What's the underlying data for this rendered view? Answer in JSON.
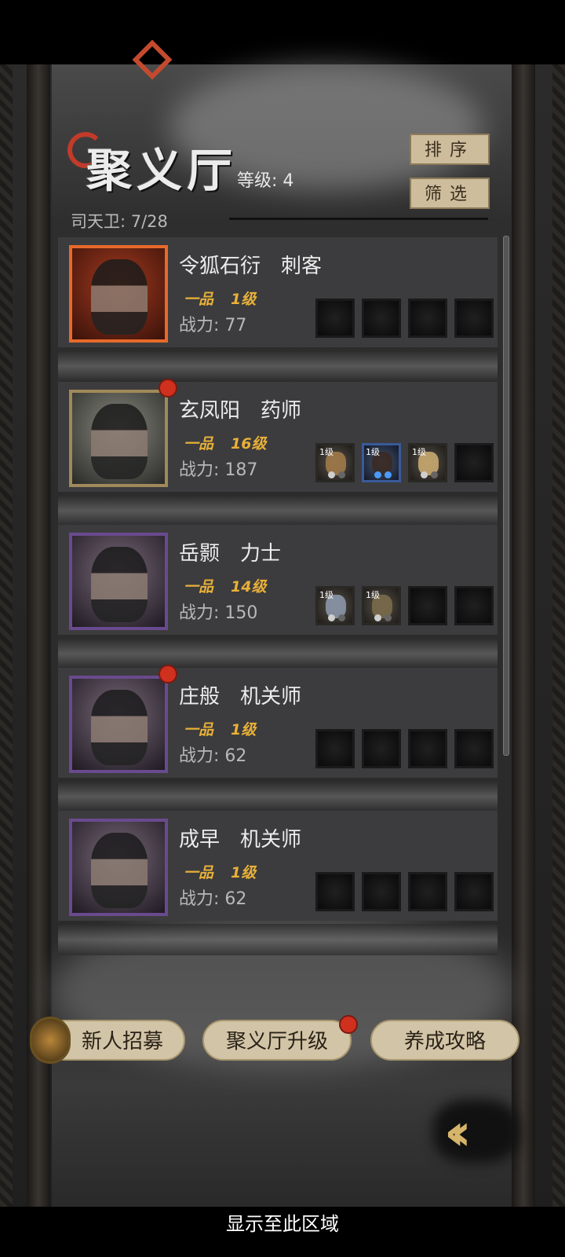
{
  "header": {
    "title": "聚义厅",
    "level_label": "等级: 4",
    "count_label": "司天卫: 7/28"
  },
  "buttons": {
    "sort": "排序",
    "filter": "筛选"
  },
  "cards": [
    {
      "name": "令狐石衍",
      "role": "刺客",
      "grade": "一品",
      "level": "1级",
      "power": "战力: 77",
      "frame": "orange",
      "dot": false
    },
    {
      "name": "玄凤阳",
      "role": "药师",
      "grade": "一品",
      "level": "16级",
      "power": "战力: 187",
      "frame": "gold",
      "dot": true
    },
    {
      "name": "岳颢",
      "role": "力士",
      "grade": "一品",
      "level": "14级",
      "power": "战力: 150",
      "frame": "purple",
      "dot": false
    },
    {
      "name": "庄般",
      "role": "机关师",
      "grade": "一品",
      "level": "1级",
      "power": "战力: 62",
      "frame": "purple",
      "dot": true
    },
    {
      "name": "成早",
      "role": "机关师",
      "grade": "一品",
      "level": "1级",
      "power": "战力: 62",
      "frame": "purple",
      "dot": false
    }
  ],
  "equipment": {
    "card1": [
      "1级",
      "1级",
      "1级"
    ],
    "card2": [
      "1级",
      "1级"
    ]
  },
  "actions": {
    "recruit": "新人招募",
    "upgrade": "聚义厅升级",
    "guide": "养成攻略"
  },
  "footer": {
    "display_area": "显示至此区域"
  },
  "icons": {
    "back": "double-chevron-left-icon"
  },
  "colors": {
    "accent_red": "#d0301e",
    "rank_gold": "#e8b038",
    "button_tan": "#d2c4a6"
  }
}
